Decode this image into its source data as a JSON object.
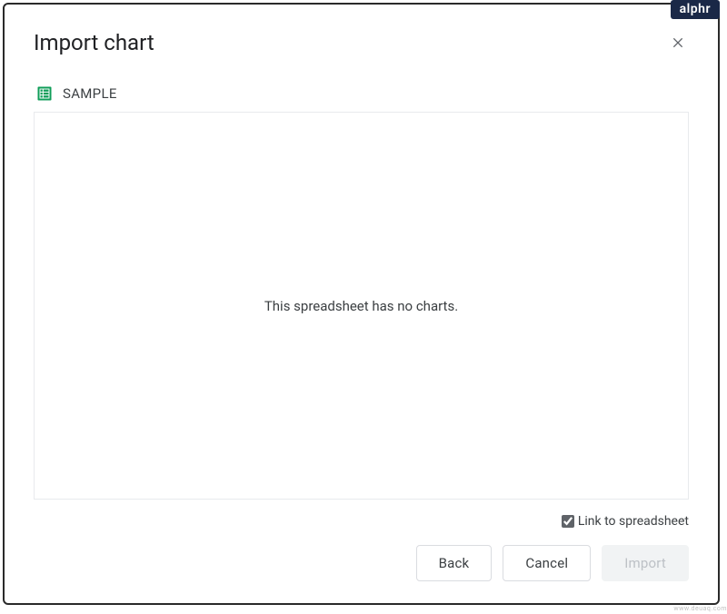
{
  "badge": "alphr",
  "dialog": {
    "title": "Import chart",
    "spreadsheet_name": "SAMPLE",
    "empty_message": "This spreadsheet has no charts.",
    "link_checkbox_label": "Link to spreadsheet",
    "link_checkbox_checked": true,
    "buttons": {
      "back": "Back",
      "cancel": "Cancel",
      "import": "Import"
    }
  },
  "watermark": "www.deuaq.com"
}
